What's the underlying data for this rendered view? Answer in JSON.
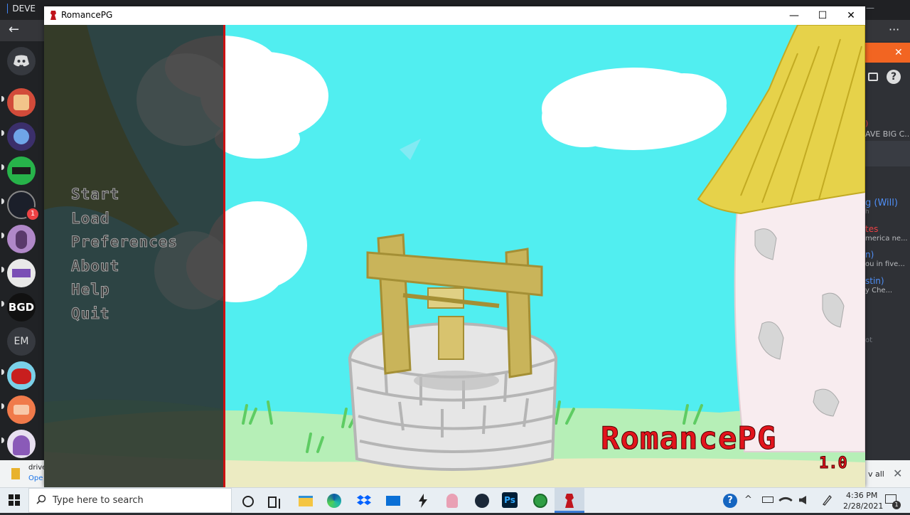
{
  "browser": {
    "tab_title": "DEVE",
    "nav_back": "←",
    "menu": "···",
    "window_controls": [
      "—",
      "☐",
      "✕"
    ]
  },
  "discord": {
    "server_initials": [
      "BGD",
      "EM"
    ],
    "notification_badge": "1",
    "help_icon": "?",
    "banner_close": "✕",
    "sidebar_fragments": [
      {
        "text": ")",
        "color": "#ed4245"
      },
      {
        "text": "AVE BIG C...",
        "color": "#b9bbbe"
      },
      {
        "text": "g (Will)",
        "color": "#4f8ff7"
      },
      {
        "text": "h",
        "color": "#72767d"
      },
      {
        "text": "tes",
        "color": "#ed4245"
      },
      {
        "text": "merica ne...",
        "color": "#b9bbbe"
      },
      {
        "text": "n)",
        "color": "#4f8ff7"
      },
      {
        "text": "ou in five...",
        "color": "#b9bbbe"
      },
      {
        "text": "stin)",
        "color": "#4f8ff7"
      },
      {
        "text": "y Che...",
        "color": "#b9bbbe"
      },
      {
        "text": "ot",
        "color": "#72767d"
      }
    ]
  },
  "downloads": {
    "file_name": "drive",
    "open_link": "Ope",
    "show_all": "v all",
    "close": "✕"
  },
  "window": {
    "title": "RomancePG",
    "minimize": "—",
    "maximize": "☐",
    "close": "✕"
  },
  "game": {
    "menu_items": [
      "Start",
      "Load",
      "Preferences",
      "About",
      "Help",
      "Quit"
    ],
    "logo": "RomancePG",
    "version": "1.0",
    "colors": {
      "sky": "#51eef0",
      "menu_panel": "#282828",
      "logo": "#e2141c",
      "divider": "#cc1111"
    }
  },
  "taskbar": {
    "search_placeholder": "Type here to search",
    "pinned": [
      "cortana-icon",
      "task-view-icon",
      "file-explorer-icon",
      "edge-icon",
      "dropbox-icon",
      "mail-icon",
      "zap-icon",
      "character-icon",
      "steam-icon",
      "photoshop-icon",
      "green-app-icon",
      "romancepg-icon"
    ],
    "photoshop_label": "Ps",
    "tray_help": "?",
    "tray_chevron": "^",
    "time": "4:36 PM",
    "date": "2/28/2021",
    "notifications_badge": "1"
  }
}
